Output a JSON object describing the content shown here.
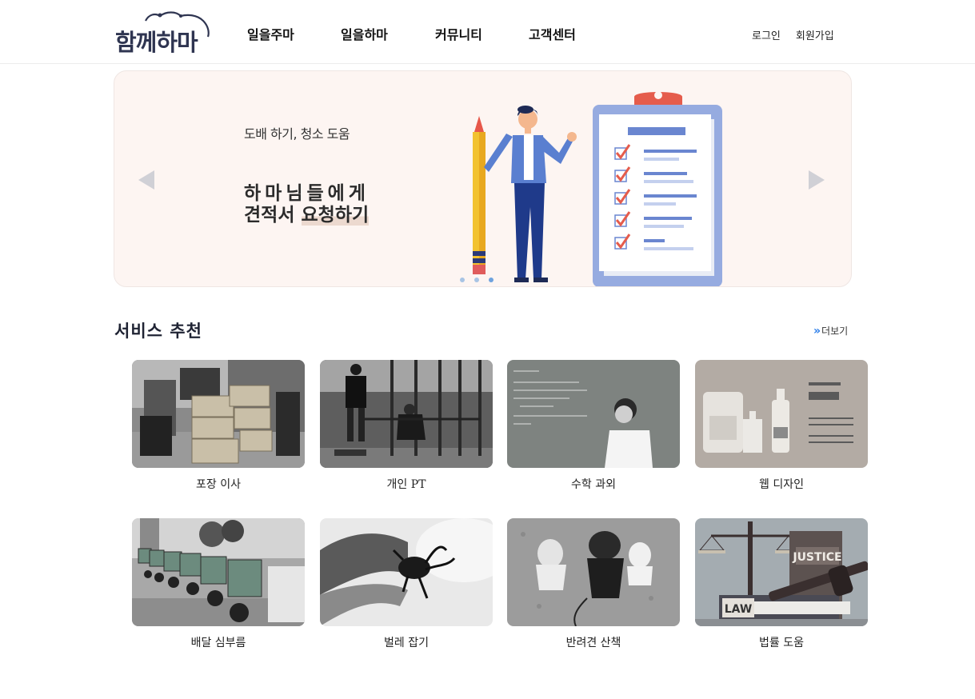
{
  "header": {
    "logo_text": "함께하마",
    "nav": [
      "일을주마",
      "일을하마",
      "커뮤니티",
      "고객센터"
    ],
    "login": "로그인",
    "signup": "회원가입"
  },
  "banner": {
    "subtitle": "도배 하기, 청소 도움",
    "headline_line1": "하마님들에게",
    "headline_line2_plain": "견적서 ",
    "headline_line2_highlight": "요청하기",
    "slide_count": 3,
    "active_slide": 3
  },
  "services": {
    "title": "서비스 추천",
    "more_label": "더보기",
    "items": [
      {
        "label": "포장 이사",
        "image": "moving-boxes-photo"
      },
      {
        "label": "개인 PT",
        "image": "gym-training-photo"
      },
      {
        "label": "수학 과외",
        "image": "math-tutor-photo"
      },
      {
        "label": "웹 디자인",
        "image": "product-design-photo"
      },
      {
        "label": "배달 심부름",
        "image": "delivery-scooters-photo"
      },
      {
        "label": "벌레 잡기",
        "image": "beetle-photo"
      },
      {
        "label": "반려견 산책",
        "image": "dogs-walk-photo"
      },
      {
        "label": "법률 도움",
        "image": "law-justice-photo"
      }
    ]
  },
  "colors": {
    "banner_bg": "#fdf5f2",
    "logo": "#2f3551",
    "accent": "#2b7de9"
  }
}
